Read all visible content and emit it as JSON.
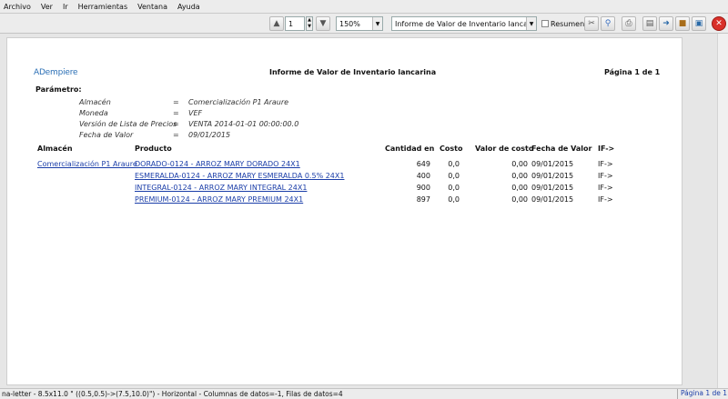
{
  "menu": [
    "Archivo",
    "Ver",
    "Ir",
    "Herramientas",
    "Ventana",
    "Ayuda"
  ],
  "toolbar": {
    "page_input": "1",
    "zoom": "150%",
    "report_select": "Informe de Valor de Inventario lancarina",
    "summary_label": "Resumen"
  },
  "report": {
    "logo": "ADempiere",
    "title": "Informe de Valor de Inventario lancarina",
    "page": "Página 1 de 1",
    "param_heading": "Parámetro:",
    "params": [
      {
        "label": "Almacén",
        "eq": "=",
        "value": "Comercialización P1 Araure"
      },
      {
        "label": "Moneda",
        "eq": "=",
        "value": "VEF"
      },
      {
        "label": "Versión de Lista de Precios",
        "eq": "=",
        "value": "VENTA 2014-01-01 00:00:00.0"
      },
      {
        "label": "Fecha de Valor",
        "eq": "=",
        "value": "09/01/2015"
      }
    ],
    "columns": {
      "warehouse": "Almacén",
      "product": "Producto",
      "qty": "Cantidad en",
      "cost": "Costo",
      "cost_value": "Valor de costo",
      "date": "Fecha de Valor",
      "if": "IF->"
    },
    "warehouse_value": "Comercialización P1 Araure",
    "rows": [
      {
        "product": "DORADO-0124 - ARROZ MARY DORADO 24X1",
        "qty": "649",
        "cost": "0,0",
        "cost_value": "0,00",
        "date": "09/01/2015",
        "if": "IF->"
      },
      {
        "product": "ESMERALDA-0124 - ARROZ MARY ESMERALDA 0.5% 24X1",
        "qty": "400",
        "cost": "0,0",
        "cost_value": "0,00",
        "date": "09/01/2015",
        "if": "IF->"
      },
      {
        "product": "INTEGRAL-0124 - ARROZ MARY INTEGRAL 24X1",
        "qty": "900",
        "cost": "0,0",
        "cost_value": "0,00",
        "date": "09/01/2015",
        "if": "IF->"
      },
      {
        "product": "PREMIUM-0124 - ARROZ MARY PREMIUM 24X1",
        "qty": "897",
        "cost": "0,0",
        "cost_value": "0,00",
        "date": "09/01/2015",
        "if": "IF->"
      }
    ]
  },
  "status": {
    "text": "na-letter - 8.5x11.0 \" ((0.5,0.5)->(7.5,10.0)\") - Horizontal - Columnas de datos=-1, Filas de datos=4",
    "page": "Página 1 de 1"
  },
  "icons": [
    "arrow-up-icon",
    "arrow-down-icon",
    "scissors-icon",
    "magnifier-icon",
    "print-icon",
    "export-icon",
    "archive-icon",
    "send-icon",
    "close-icon"
  ]
}
